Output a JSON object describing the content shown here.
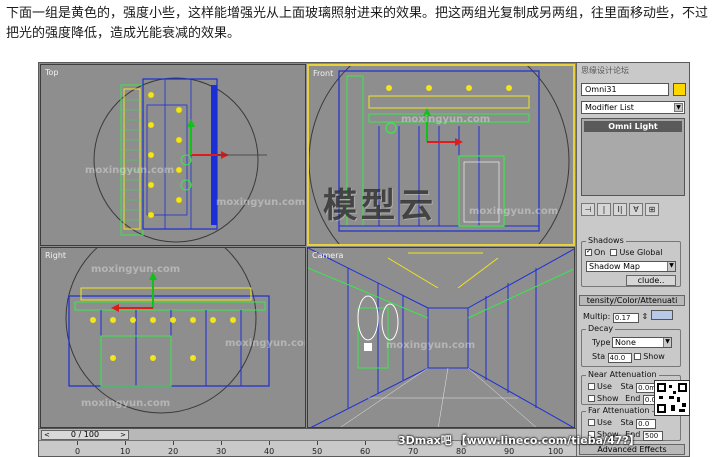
{
  "caption": "下面一组是黄色的，强度小些，这样能增强光从上面玻璃照射进来的效果。把这两组光复制成另两组，往里面移动些，不过把光的强度降低，造成光能衰减的效果。",
  "viewports": {
    "top": {
      "label": "Top"
    },
    "front": {
      "label": "Front"
    },
    "right": {
      "label": "Right"
    },
    "camera": {
      "label": "Camera"
    }
  },
  "watermarks": {
    "site": "moxingyun.com",
    "logo": "模型云",
    "brand": "思缘设计论坛",
    "footer": "3Dmax吧 【www.lineco.com/tieba/47?】"
  },
  "command_panel": {
    "object_name": "Omni31",
    "object_color": "#ffd700",
    "modifier_list": "Modifier List",
    "stack_item": "Omni Light",
    "stack_tools": [
      "⊣",
      "|",
      "I|",
      "∀",
      "⊞"
    ],
    "shadows": {
      "title": "Shadows",
      "on_label": "On",
      "on_checked": true,
      "use_global_label": "Use Global",
      "use_global_checked": false,
      "type": "Shadow Map",
      "exclude_label": "clude.."
    },
    "intensity": {
      "title": "tensity/Color/Attenuati",
      "multiplier_label": "Multip",
      "multiplier_value": "0.17",
      "color": "#b7c9e6"
    },
    "decay": {
      "title": "Decay",
      "type_label": "Type",
      "type_value": "None",
      "start_label": "Sta",
      "start_value": "40.0",
      "show_label": "Show"
    },
    "near_atten": {
      "title": "Near Attenuation",
      "use_label": "Use",
      "start_label": "Sta",
      "start_value": "0.0mm",
      "show_label": "Show",
      "end_label": "End",
      "end_value": "0.0"
    },
    "far_atten": {
      "title": "Far Attenuation",
      "use_label": "Use",
      "start_label": "Sta",
      "start_value": "0.0",
      "show_label": "Show",
      "end_label": "End",
      "end_value": "500"
    },
    "advanced": "Advanced Effects"
  },
  "timeline": {
    "frame_display": "0 / 100",
    "left_arrow": "<",
    "right_arrow": ">",
    "ticks": [
      "0",
      "10",
      "20",
      "30",
      "40",
      "50",
      "60",
      "70",
      "80",
      "90",
      "100"
    ]
  },
  "colors": {
    "viewport_bg": "#8e8e8e",
    "active_border": "#e7d23c",
    "wire_blue": "#1c2fd6",
    "wire_green": "#38e84a",
    "wire_yellow": "#f2e51e",
    "axis_red": "#e01b1b",
    "axis_green": "#12c01a"
  }
}
